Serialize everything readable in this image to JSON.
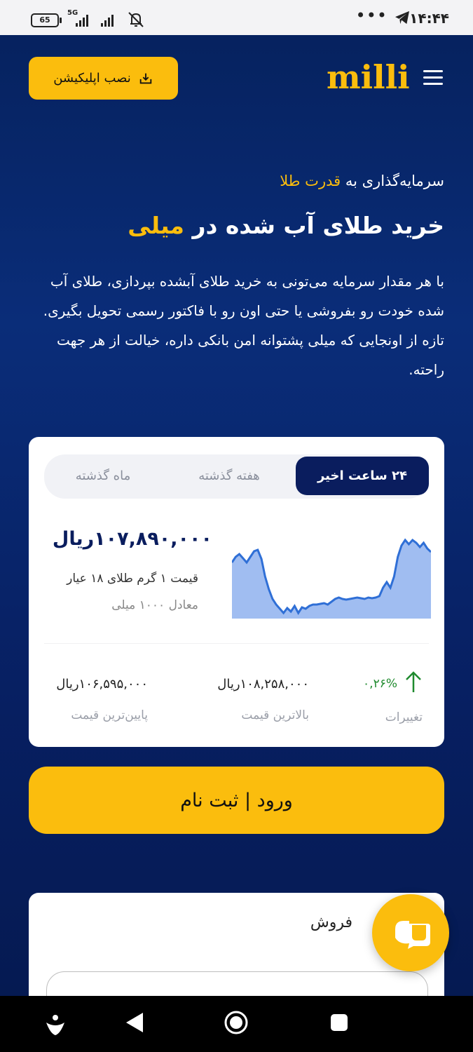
{
  "status_bar": {
    "time": "۱۴:۴۴",
    "dots": "•••",
    "battery": "65",
    "network": "5G"
  },
  "header": {
    "install_label": "نصب اپلیکیشن",
    "logo_text": "milli"
  },
  "hero": {
    "subtitle_prefix": "سرمایه‌گذاری به",
    "subtitle_gold": "قدرت طلا",
    "title_prefix": "خرید طلای آب شده در",
    "title_gold": "میلی",
    "description": "با هر مقدار سرمایه می‌تونی به خرید طلای آبشده بپردازی، طلای آب شده خودت رو بفروشی یا حتی اون رو با فاکتور رسمی تحویل بگیری. تازه از اونجایی که میلی پشتوانه امن بانکی داره، خیالت از هر جهت راحته."
  },
  "price_card": {
    "tabs": [
      {
        "label": "۲۴ ساعت اخیر",
        "active": true
      },
      {
        "label": "هفته گذشته",
        "active": false
      },
      {
        "label": "ماه گذشته",
        "active": false
      }
    ],
    "price": "۱۰۷,۸۹۰,۰۰۰ریال",
    "price_label": "قیمت ۱ گرم طلای ۱۸ عیار",
    "equivalent": "معادل ۱۰۰۰ میلی",
    "stats": {
      "change_value": "۰,۲۶%",
      "change_label": "تغییرات",
      "high_value": "۱۰۸,۲۵۸,۰۰۰ریال",
      "high_label": "بالاترین قیمت",
      "low_value": "۱۰۶,۵۹۵,۰۰۰ریال",
      "low_label": "پایین‌ترین قیمت"
    },
    "colors": {
      "chart_line": "#2f6fd6",
      "chart_fill": "#8fb2ee",
      "up": "#1f8a2e"
    }
  },
  "chart_data": {
    "type": "area",
    "y": [
      80,
      88,
      92,
      86,
      80,
      88,
      96,
      98,
      85,
      60,
      42,
      28,
      20,
      14,
      8,
      15,
      10,
      18,
      8,
      16,
      14,
      18,
      20,
      20,
      21,
      22,
      20,
      24,
      28,
      30,
      28,
      27,
      28,
      29,
      30,
      29,
      28,
      30,
      29,
      30,
      32,
      44,
      52,
      44,
      60,
      88,
      104,
      112,
      106,
      112,
      108,
      102,
      108,
      100,
      95
    ],
    "series_color": "#2f6fd6"
  },
  "actions": {
    "login_label": "ورود | ثبت نام",
    "sell_label": "فروش"
  },
  "colors": {
    "accent": "#fbbd0d",
    "background": "#0a2d79",
    "active_tab": "#0a1d5e"
  }
}
